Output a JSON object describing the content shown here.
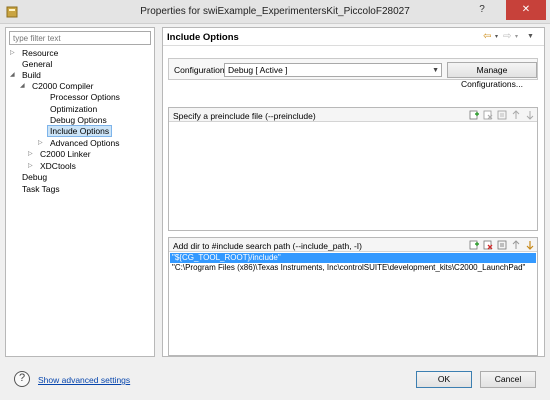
{
  "window": {
    "title": "Properties for swiExample_ExperimentersKit_PiccoloF28027",
    "help_label": "?",
    "close_label": "✕"
  },
  "sidebar": {
    "filter_placeholder": "type filter text",
    "items": [
      {
        "label": "Resource",
        "arrow": "▷"
      },
      {
        "label": "General",
        "arrow": ""
      },
      {
        "label": "Build",
        "arrow": "◢"
      },
      {
        "label": "C2000 Compiler",
        "arrow": "◢"
      },
      {
        "label": "Processor Options",
        "arrow": ""
      },
      {
        "label": "Optimization",
        "arrow": ""
      },
      {
        "label": "Debug Options",
        "arrow": ""
      },
      {
        "label": "Include Options",
        "arrow": ""
      },
      {
        "label": "Advanced Options",
        "arrow": "▷"
      },
      {
        "label": "C2000 Linker",
        "arrow": "▷"
      },
      {
        "label": "XDCtools",
        "arrow": "▷"
      },
      {
        "label": "Debug",
        "arrow": ""
      },
      {
        "label": "Task Tags",
        "arrow": ""
      }
    ]
  },
  "main": {
    "page_title": "Include Options",
    "nav": {
      "back": "⇦",
      "forward": "⇨",
      "menu": "▾",
      "view_menu": "▼"
    },
    "configuration": {
      "label": "Configuration:",
      "value": "Debug  [ Active ]",
      "manage_button": "Manage Configurations..."
    },
    "preinclude": {
      "title": "Specify a preinclude file (--preinclude)",
      "rows": []
    },
    "include_paths": {
      "title": "Add dir to #include search path (--include_path, -I)",
      "rows": [
        "\"${CG_TOOL_ROOT}/include\"",
        "\"C:\\Program Files (x86)\\Texas Instruments, Inc\\controlSUITE\\development_kits\\C2000_LaunchPad\""
      ]
    }
  },
  "footer": {
    "help_icon": "?",
    "show_advanced": "Show advanced settings",
    "ok": "OK",
    "cancel": "Cancel"
  },
  "colors": {
    "selection": "#3399ff",
    "tree_selection": "#cce4f7",
    "close_button": "#c7413a"
  }
}
